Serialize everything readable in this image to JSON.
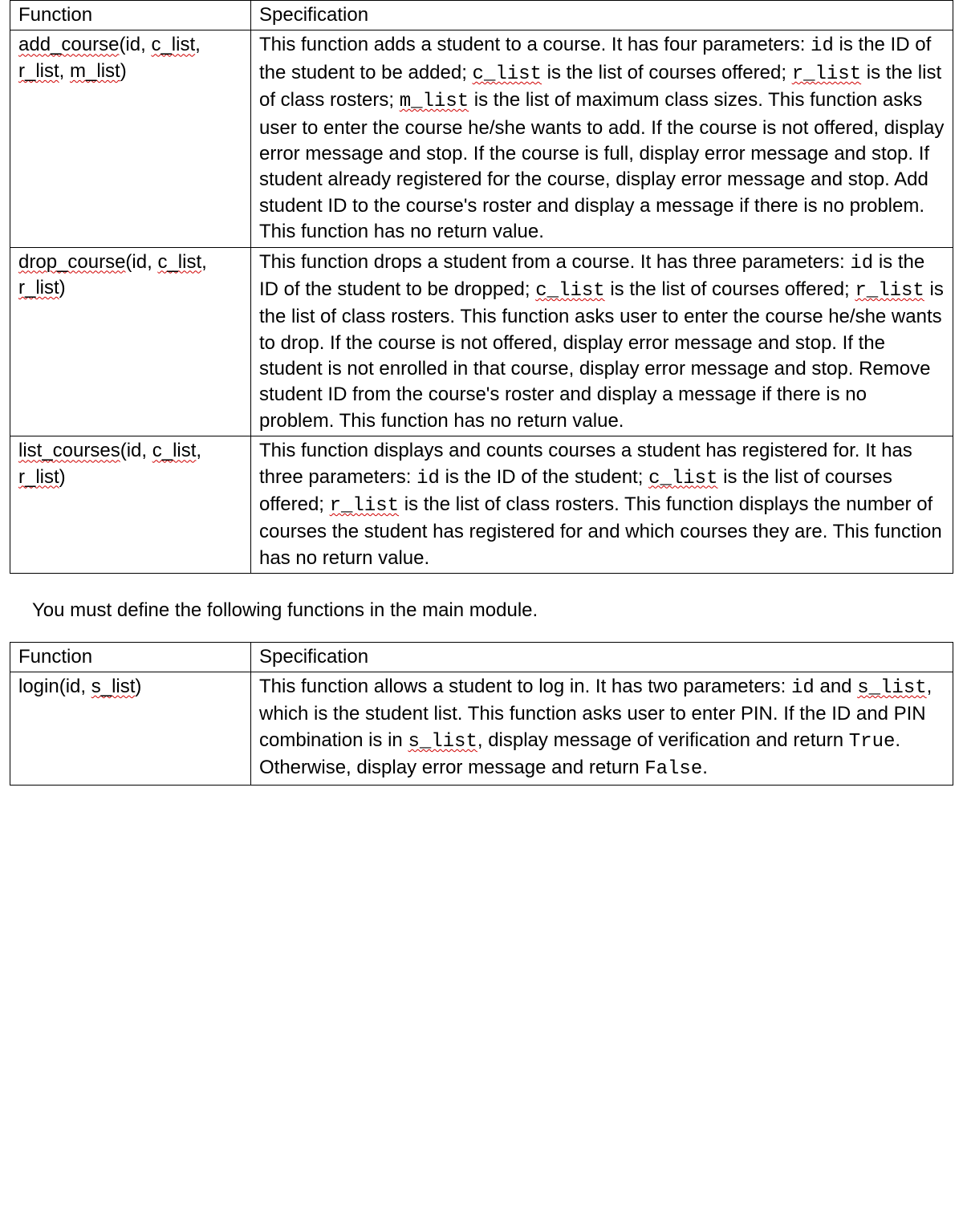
{
  "table1": {
    "headers": {
      "col1": "Function",
      "col2": "Specification"
    },
    "rows": [
      {
        "sig": {
          "fn": "add_course",
          "open": "(id, ",
          "p1": "c_list",
          "sep1": ", ",
          "p2": "r_list",
          "sep2": ", ",
          "p3": "m_list",
          "close": ")"
        },
        "spec": {
          "t0": "This function adds a student to a course.  It has four parameters: ",
          "c0": "id",
          "t1": " is the ID of the student to be added; ",
          "c1": "c_list",
          "t2": " is the list of courses offered; ",
          "c2": "r_list",
          "t3": " is the list of class rosters; ",
          "c3": "m_list",
          "t4": " is the list of maximum class sizes.  This function asks user to enter the course he/she wants to add.  If the course is not offered, display error message and stop.  If the course is full, display error message and stop.  If student already registered for the course, display error message and stop.  Add student ID to the course's roster and display a message if there is no problem.  This function has no return value."
        }
      },
      {
        "sig": {
          "fn": "drop_course",
          "open": "(id, ",
          "p1": "c_list",
          "sep1": ", ",
          "p2": "r_list",
          "close": ")"
        },
        "spec": {
          "t0": "This function drops a student from a course.  It has three parameters: ",
          "c0": "id",
          "t1": " is the ID of the student to be dropped; ",
          "c1": "c_list",
          "t2": " is the list of courses offered; ",
          "c2": "r_list",
          "t3": " is the list of class rosters. This function asks user to enter the course he/she wants to drop.  If the course is not offered, display error message and stop.  If the student is not enrolled in that course, display error message and stop.  Remove student ID from the course's roster and display a message if there is no problem.  This function has no return value."
        }
      },
      {
        "sig": {
          "fn": "list_courses",
          "open": "(id, ",
          "p1": "c_list",
          "sep1": ", ",
          "p2": "r_list",
          "close": ")"
        },
        "spec": {
          "t0": "This function displays and counts courses a student has registered for.  It has three parameters: ",
          "c0": "id",
          "t1": " is the ID of the student; ",
          "c1": "c_list",
          "t2": " is the list of courses offered; ",
          "c2": "r_list",
          "t3": " is the list of class rosters. This function displays the number of courses the student has registered for and which courses they are.  This function has no return value."
        }
      }
    ]
  },
  "intertext": "You must define the following functions in the main module.",
  "table2": {
    "headers": {
      "col1": "Function",
      "col2": "Specification"
    },
    "rows": [
      {
        "sig": {
          "pre": "login(id, ",
          "p1": "s_list",
          "close": ")"
        },
        "spec": {
          "t0": "This function allows a student to log in.  It has two parameters: ",
          "c0": "id",
          "t1": " and ",
          "c1": "s_list",
          "t2": ", which is the student list.  This function asks user to enter PIN. If the ID and PIN combination is in ",
          "c2": "s_list",
          "t3": ", display message of verification and return ",
          "c3": "True",
          "t4": ".  Otherwise, display error message and return ",
          "c4": "False",
          "t5": "."
        }
      }
    ]
  }
}
